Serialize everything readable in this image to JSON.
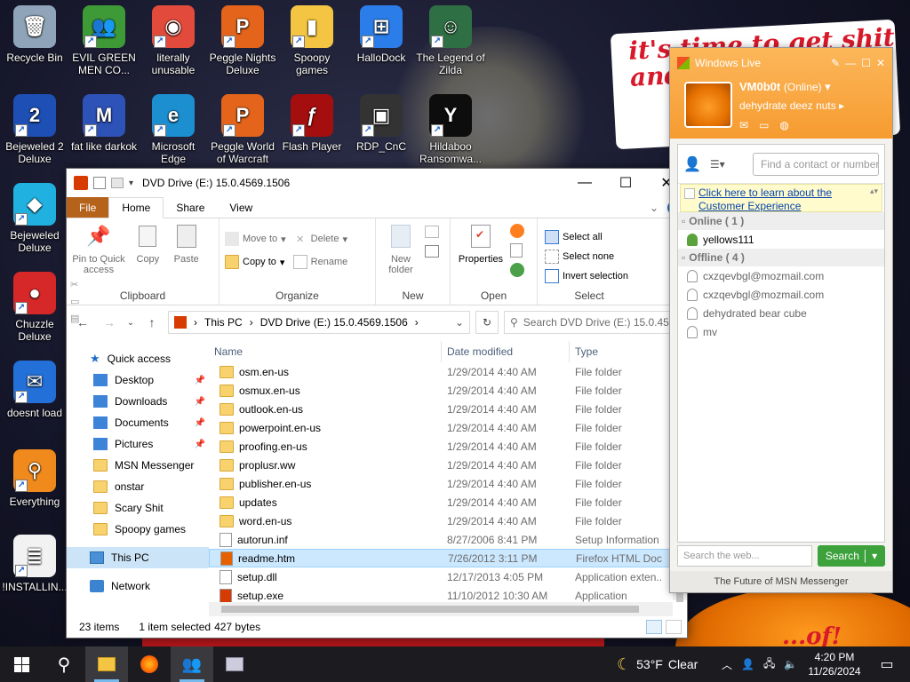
{
  "desktop": {
    "icons": [
      {
        "label": "Recycle Bin",
        "color": "#8fa4b8",
        "glyph": "🗑"
      },
      {
        "label": "EVIL GREEN MEN CO...",
        "color": "#3d9a36",
        "glyph": "👥"
      },
      {
        "label": "literally unusable",
        "color": "#e24b3b",
        "glyph": "◉"
      },
      {
        "label": "Peggle Nights Deluxe",
        "color": "#e3641a",
        "glyph": "P"
      },
      {
        "label": "Spoopy games",
        "color": "#f4c542",
        "glyph": "▮"
      },
      {
        "label": "HalloDock",
        "color": "#2b7de9",
        "glyph": "⊞"
      },
      {
        "label": "The Legend of Zilda",
        "color": "#2f6f44",
        "glyph": "☺"
      },
      {
        "label": "Bejeweled 2 Deluxe",
        "color": "#1e4fb5",
        "glyph": "2"
      },
      {
        "label": "fat like darkok",
        "color": "#2d52b8",
        "glyph": "M"
      },
      {
        "label": "Microsoft Edge",
        "color": "#1c8fd1",
        "glyph": "e"
      },
      {
        "label": "Peggle World of Warcraft",
        "color": "#e3641a",
        "glyph": "P"
      },
      {
        "label": "Flash Player",
        "color": "#a50e0e",
        "glyph": "ƒ"
      },
      {
        "label": "RDP_CnC",
        "color": "#333333",
        "glyph": "▣"
      },
      {
        "label": "Hildaboo Ransomwa...",
        "color": "#0d0d0d",
        "glyph": "Y"
      },
      {
        "label": "Bejeweled Deluxe",
        "color": "#21b1e0",
        "glyph": "◆"
      },
      {
        "label": "Chuzzle Deluxe",
        "color": "#d62828",
        "glyph": "●"
      },
      {
        "label": "doesnt load",
        "color": "#2270d8",
        "glyph": "✉"
      },
      {
        "label": "Everything",
        "color": "#f08a1c",
        "glyph": "⚲"
      },
      {
        "label": "!INSTALLIN...",
        "color": "#f2f2f2",
        "glyph": "≣"
      }
    ]
  },
  "wallpaper": {
    "sign_text": "it's time to get shit and ... or t...",
    "bottom_text": "...of!"
  },
  "explorer": {
    "title": "DVD Drive (E:) 15.0.4569.1506",
    "tabs": {
      "file": "File",
      "home": "Home",
      "share": "Share",
      "view": "View"
    },
    "ribbon": {
      "clipboard": {
        "label": "Clipboard",
        "pin": "Pin to Quick access",
        "copy": "Copy",
        "paste": "Paste"
      },
      "organize": {
        "label": "Organize",
        "move_to": "Move to",
        "copy_to": "Copy to",
        "delete": "Delete",
        "rename": "Rename"
      },
      "new": {
        "label": "New",
        "new_folder": "New folder"
      },
      "open": {
        "label": "Open",
        "properties": "Properties"
      },
      "select": {
        "label": "Select",
        "select_all": "Select all",
        "select_none": "Select none",
        "invert": "Invert selection"
      }
    },
    "address": {
      "crumbs": [
        "This PC",
        "DVD Drive (E:) 15.0.4569.1506"
      ],
      "search_placeholder": "Search DVD Drive (E:) 15.0.45..."
    },
    "nav_pane": {
      "quick_access": "Quick access",
      "items": [
        {
          "label": "Desktop",
          "pinned": true,
          "icon": "desktop-icon"
        },
        {
          "label": "Downloads",
          "pinned": true,
          "icon": "download-icon"
        },
        {
          "label": "Documents",
          "pinned": true,
          "icon": "documents-icon"
        },
        {
          "label": "Pictures",
          "pinned": true,
          "icon": "pictures-icon"
        },
        {
          "label": "MSN Messenger",
          "pinned": false,
          "icon": "folder-icon"
        },
        {
          "label": "onstar",
          "pinned": false,
          "icon": "folder-icon"
        },
        {
          "label": "Scary Shit",
          "pinned": false,
          "icon": "folder-icon"
        },
        {
          "label": "Spoopy games",
          "pinned": false,
          "icon": "folder-icon"
        }
      ],
      "this_pc": "This PC",
      "network": "Network"
    },
    "columns": {
      "name": "Name",
      "date": "Date modified",
      "type": "Type"
    },
    "files": [
      {
        "name": "osm.en-us",
        "date": "1/29/2014 4:40 AM",
        "type": "File folder",
        "kind": "folder"
      },
      {
        "name": "osmux.en-us",
        "date": "1/29/2014 4:40 AM",
        "type": "File folder",
        "kind": "folder"
      },
      {
        "name": "outlook.en-us",
        "date": "1/29/2014 4:40 AM",
        "type": "File folder",
        "kind": "folder"
      },
      {
        "name": "powerpoint.en-us",
        "date": "1/29/2014 4:40 AM",
        "type": "File folder",
        "kind": "folder"
      },
      {
        "name": "proofing.en-us",
        "date": "1/29/2014 4:40 AM",
        "type": "File folder",
        "kind": "folder"
      },
      {
        "name": "proplusr.ww",
        "date": "1/29/2014 4:40 AM",
        "type": "File folder",
        "kind": "folder"
      },
      {
        "name": "publisher.en-us",
        "date": "1/29/2014 4:40 AM",
        "type": "File folder",
        "kind": "folder"
      },
      {
        "name": "updates",
        "date": "1/29/2014 4:40 AM",
        "type": "File folder",
        "kind": "folder"
      },
      {
        "name": "word.en-us",
        "date": "1/29/2014 4:40 AM",
        "type": "File folder",
        "kind": "folder"
      },
      {
        "name": "autorun.inf",
        "date": "8/27/2006 8:41 PM",
        "type": "Setup Information",
        "kind": "file"
      },
      {
        "name": "readme.htm",
        "date": "7/26/2012 3:11 PM",
        "type": "Firefox HTML Doc...",
        "kind": "html",
        "selected": true
      },
      {
        "name": "setup.dll",
        "date": "12/17/2013 4:05 PM",
        "type": "Application exten...",
        "kind": "file"
      },
      {
        "name": "setup.exe",
        "date": "11/10/2012 10:30 AM",
        "type": "Application",
        "kind": "exe"
      }
    ],
    "status": {
      "count": "23 items",
      "selected": "1 item selected",
      "size": "427 bytes"
    }
  },
  "msn": {
    "title": "Windows Live",
    "name": "VM0b0t",
    "status": "(Online)",
    "psm": "dehydrate deez nuts",
    "find_placeholder": "Find a contact or number...",
    "promo": "Click here to learn about the Customer Experience",
    "online_group": "Online ( 1 )",
    "online": [
      "yellows111"
    ],
    "offline_group": "Offline ( 4 )",
    "offline": [
      "cxzqevbgl@mozmail.com",
      "cxzqevbgl@mozmail.com",
      "dehydrated bear cube",
      "mv"
    ],
    "web_search_placeholder": "Search the web...",
    "search_button": "Search",
    "footer": "The Future of MSN Messenger"
  },
  "taskbar": {
    "weather_temp": "53°F",
    "weather_desc": "Clear",
    "time": "4:20 PM",
    "date": "11/26/2024",
    "accent": "#76b9ed"
  }
}
